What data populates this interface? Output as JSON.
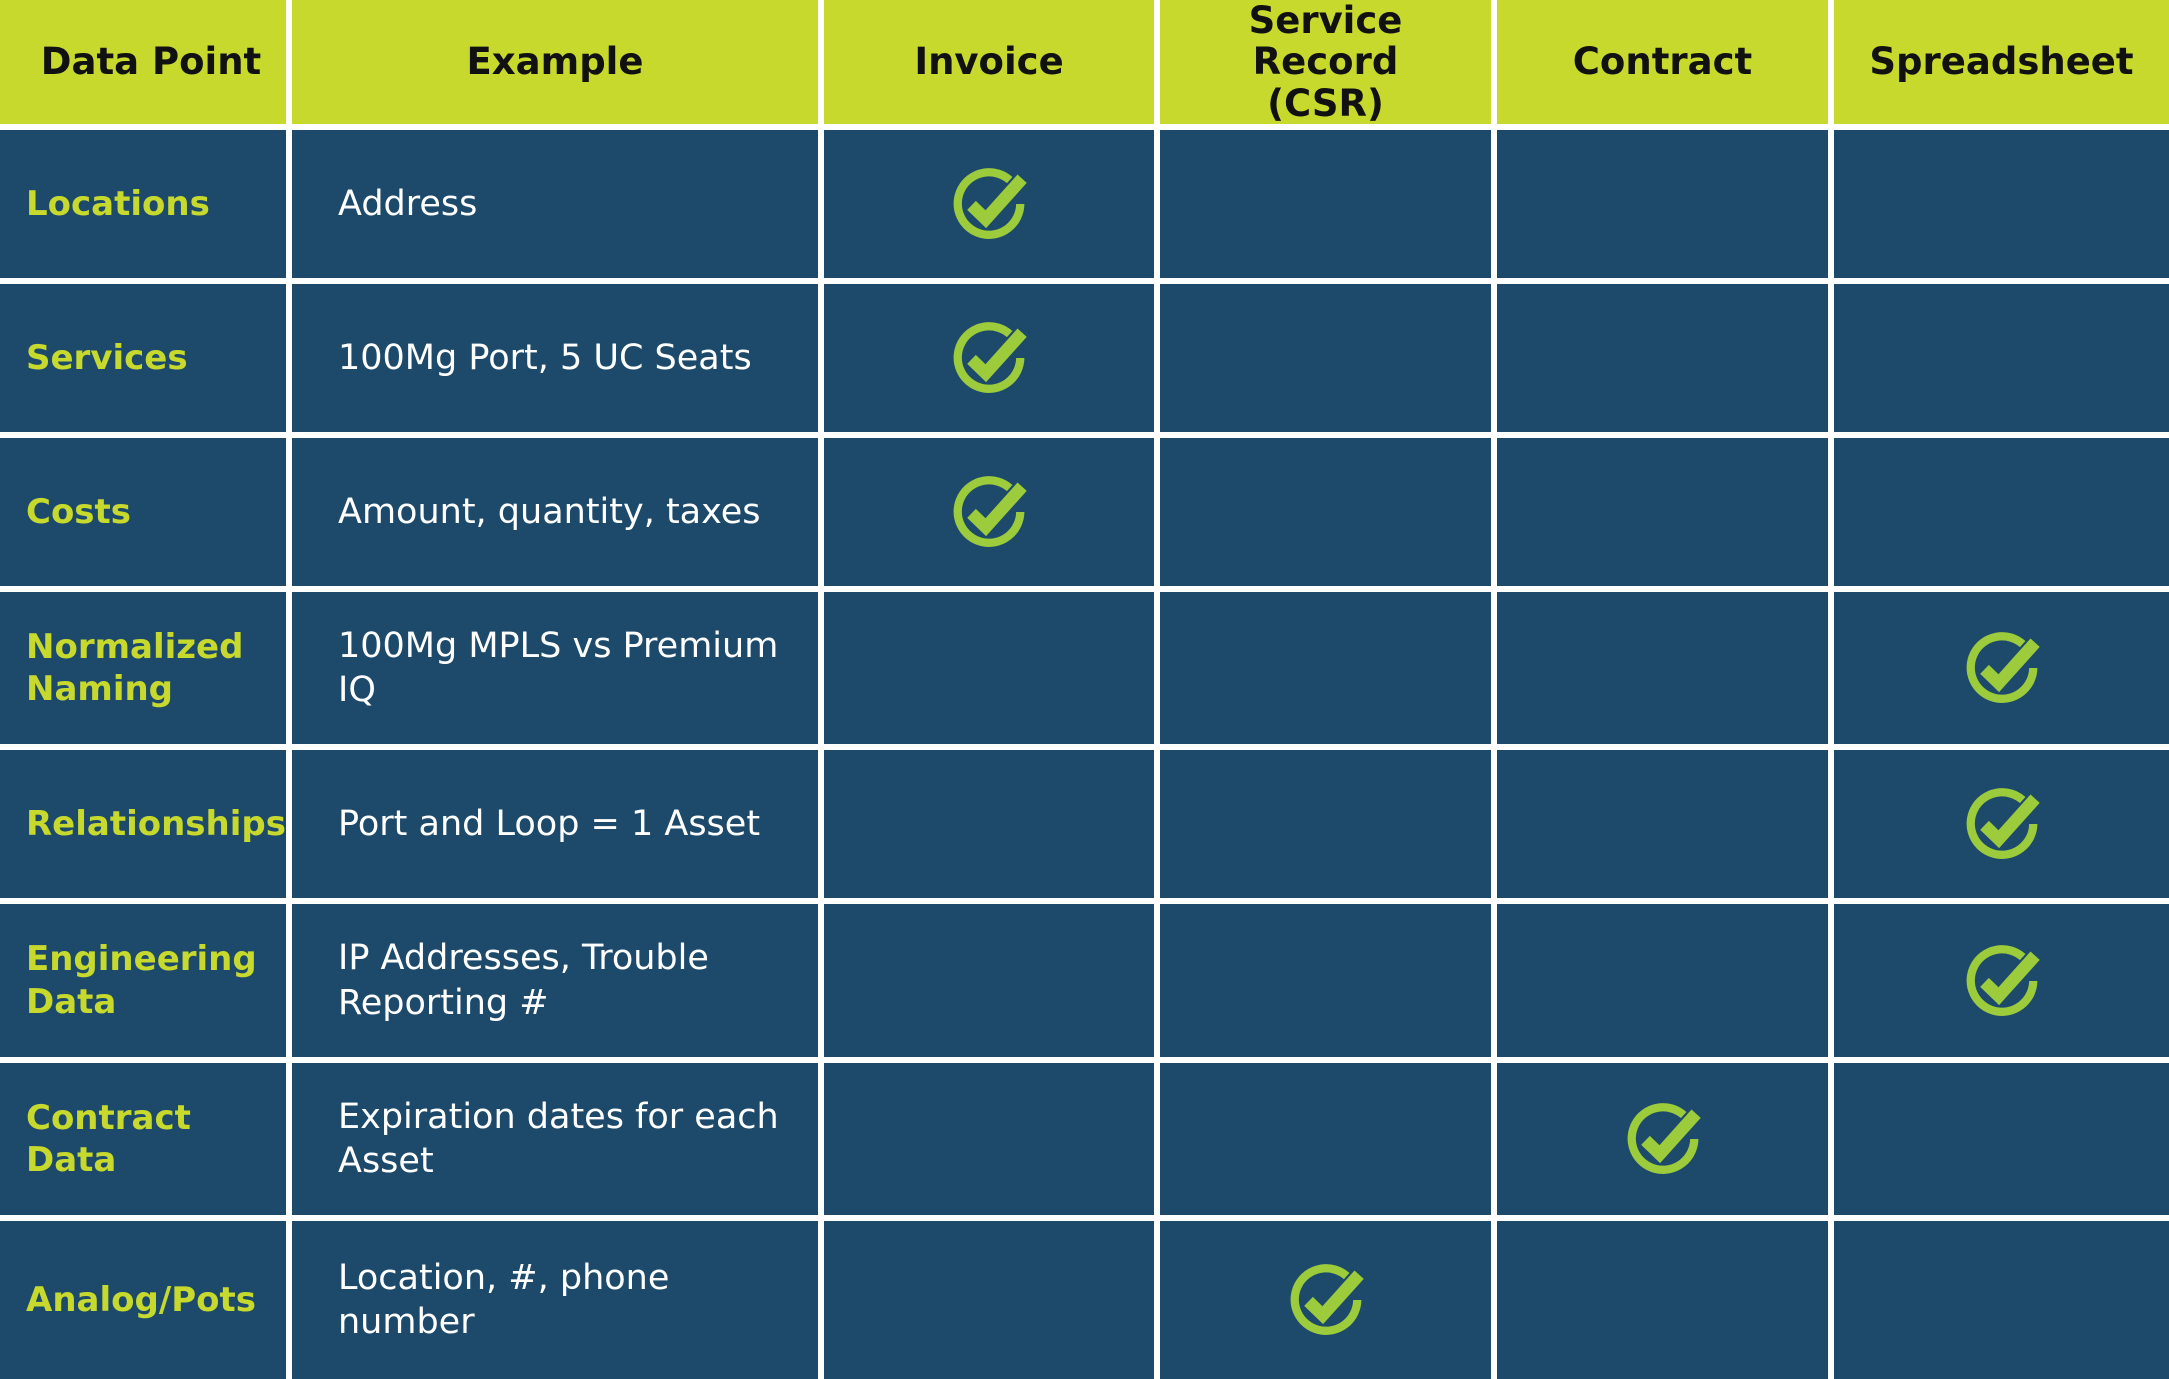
{
  "colors": {
    "header_green": "#c7d92d",
    "cell_blue": "#1d4a6b",
    "check_green": "#9ccb3b",
    "label_green": "#c7d92d",
    "text_white": "#ffffff",
    "grid_white": "#ffffff",
    "header_text": "#111111"
  },
  "table": {
    "columns": [
      {
        "key": "data_point",
        "label": "Data Point"
      },
      {
        "key": "example",
        "label": "Example"
      },
      {
        "key": "invoice",
        "label": "Invoice"
      },
      {
        "key": "csr",
        "label": "Service Record\n(CSR)"
      },
      {
        "key": "contract",
        "label": "Contract"
      },
      {
        "key": "spreadsheet",
        "label": "Spreadsheet"
      }
    ],
    "header_labels": {
      "data_point": "Data Point",
      "example": "Example",
      "invoice": "Invoice",
      "csr_line1": "Service Record",
      "csr_line2": "(CSR)",
      "contract": "Contract",
      "spreadsheet": "Spreadsheet"
    },
    "check_icon_name": "circle-check-icon",
    "rows": [
      {
        "data_point": "Locations",
        "example": "Address",
        "invoice": true,
        "csr": false,
        "contract": false,
        "spreadsheet": false
      },
      {
        "data_point": "Services",
        "example": "100Mg Port, 5 UC Seats",
        "invoice": true,
        "csr": false,
        "contract": false,
        "spreadsheet": false
      },
      {
        "data_point": "Costs",
        "example": "Amount, quantity, taxes",
        "invoice": true,
        "csr": false,
        "contract": false,
        "spreadsheet": false
      },
      {
        "data_point": "Normalized Naming",
        "example": "100Mg MPLS vs Premium IQ",
        "invoice": false,
        "csr": false,
        "contract": false,
        "spreadsheet": true
      },
      {
        "data_point": "Relationships",
        "example": "Port and Loop = 1 Asset",
        "invoice": false,
        "csr": false,
        "contract": false,
        "spreadsheet": true
      },
      {
        "data_point": "Engineering Data",
        "example": "IP Addresses, Trouble Reporting #",
        "invoice": false,
        "csr": false,
        "contract": false,
        "spreadsheet": true
      },
      {
        "data_point": "Contract Data",
        "example": "Expiration dates for each Asset",
        "invoice": false,
        "csr": false,
        "contract": true,
        "spreadsheet": false
      },
      {
        "data_point": "Analog/Pots",
        "example": "Location, #, phone number",
        "invoice": false,
        "csr": true,
        "contract": false,
        "spreadsheet": false
      }
    ]
  }
}
